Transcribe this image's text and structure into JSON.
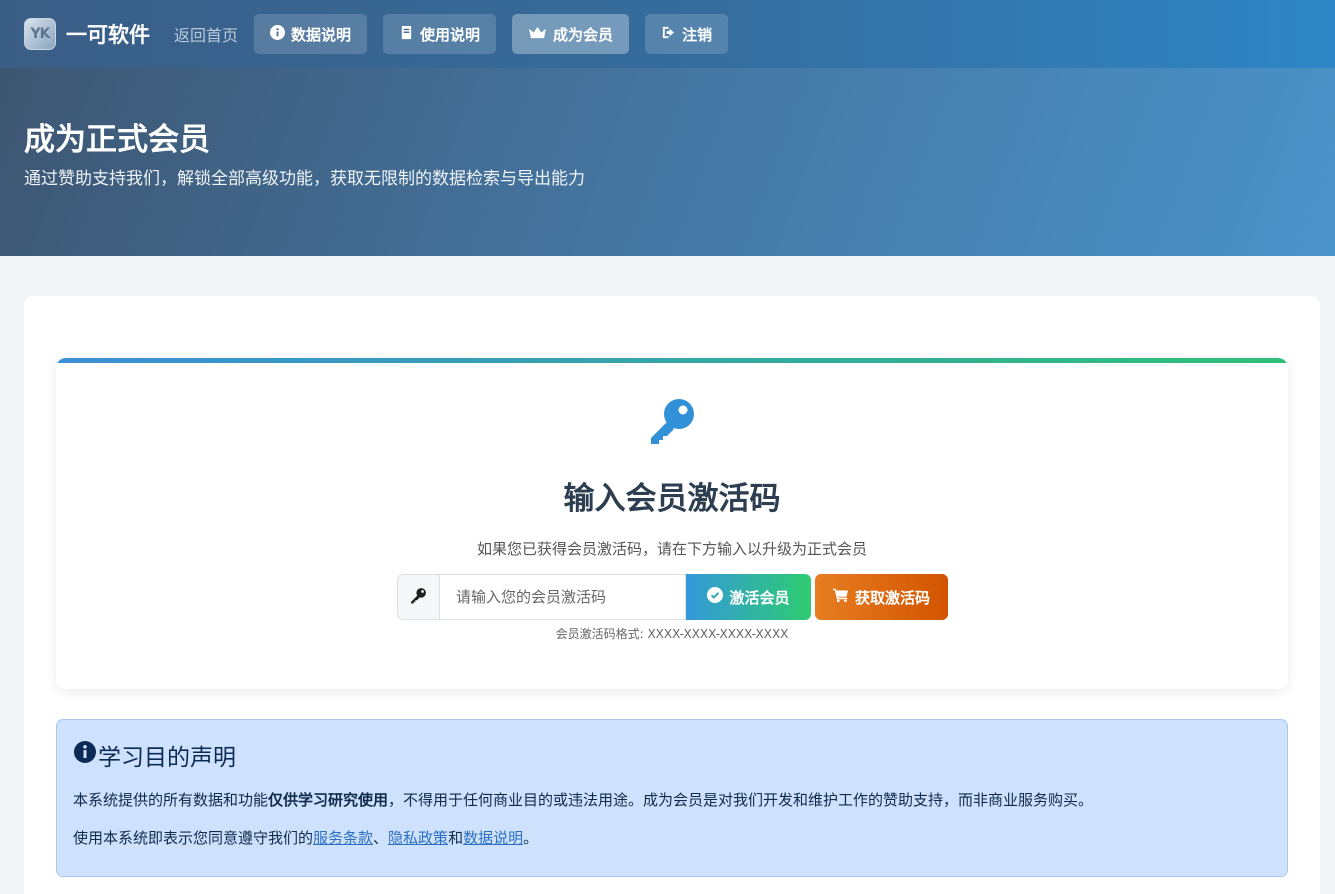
{
  "header": {
    "logo_text": "YK",
    "brand": "一可软件",
    "home_link": "返回首页",
    "nav": [
      {
        "label": "数据说明",
        "icon": "info-circle-icon"
      },
      {
        "label": "使用说明",
        "icon": "book-icon"
      },
      {
        "label": "成为会员",
        "icon": "crown-icon",
        "active": true
      },
      {
        "label": "注销",
        "icon": "sign-out-icon"
      }
    ]
  },
  "hero": {
    "title": "成为正式会员",
    "subtitle": "通过赞助支持我们，解锁全部高级功能，获取无限制的数据检索与导出能力"
  },
  "activation": {
    "icon": "key-icon",
    "title": "输入会员激活码",
    "subtitle": "如果您已获得会员激活码，请在下方输入以升级为正式会员",
    "input_placeholder": "请输入您的会员激活码",
    "input_value": "",
    "activate_label": "激活会员",
    "get_code_label": "获取激活码",
    "format_hint": "会员激活码格式: XXXX-XXXX-XXXX-XXXX"
  },
  "notice": {
    "icon": "info-circle-icon",
    "title": "学习目的声明",
    "p1_before": "本系统提供的所有数据和功能",
    "p1_bold": "仅供学习研究使用",
    "p1_after": "，不得用于任何商业目的或违法用途。成为会员是对我们开发和维护工作的赞助支持，而非商业服务购买。",
    "p2_before": "使用本系统即表示您同意遵守我们的",
    "link_terms": "服务条款",
    "sep1": "、",
    "link_privacy": "隐私政策",
    "sep2": "和",
    "link_data": "数据说明",
    "p2_end": "。"
  },
  "colors": {
    "accent_blue": "#3498db",
    "accent_green": "#2ecc71",
    "accent_orange": "#e67e22",
    "notice_bg": "#cfe2fd"
  }
}
